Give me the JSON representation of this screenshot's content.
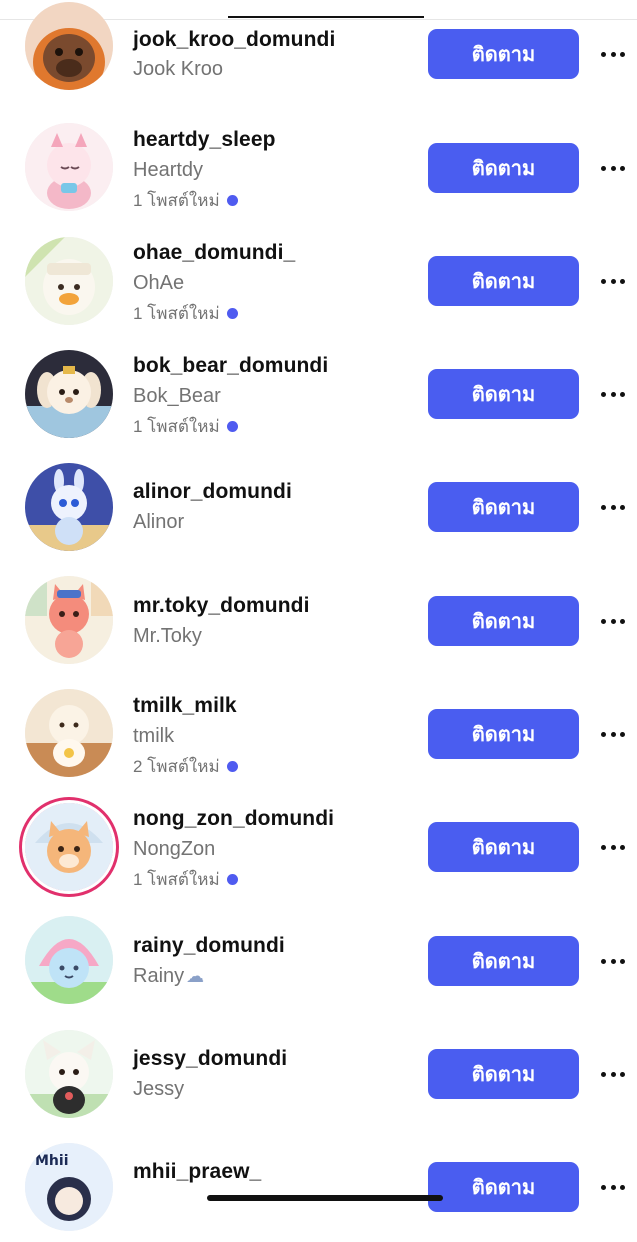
{
  "follow_label": "ติดตาม",
  "colors": {
    "accent": "#4a5df0",
    "new_post_dot": "#4f5bf0",
    "story_ring": "#e1306c",
    "secondary_text": "#737373"
  },
  "accounts": [
    {
      "username": "jook_kroo_domundi",
      "full_name": "Jook Kroo",
      "new_posts": ""
    },
    {
      "username": "heartdy_sleep",
      "full_name": "Heartdy",
      "new_posts": "1 โพสต์ใหม่"
    },
    {
      "username": "ohae_domundi_",
      "full_name": "OhAe",
      "new_posts": "1 โพสต์ใหม่"
    },
    {
      "username": "bok_bear_domundi",
      "full_name": "Bok_Bear",
      "new_posts": "1 โพสต์ใหม่"
    },
    {
      "username": "alinor_domundi",
      "full_name": "Alinor",
      "new_posts": ""
    },
    {
      "username": "mr.toky_domundi",
      "full_name": "Mr.Toky",
      "new_posts": ""
    },
    {
      "username": "tmilk_milk",
      "full_name": "tmilk",
      "new_posts": "2 โพสต์ใหม่"
    },
    {
      "username": "nong_zon_domundi",
      "full_name": "NongZon",
      "new_posts": "1 โพสต์ใหม่",
      "story_ring": true
    },
    {
      "username": "rainy_domundi",
      "full_name": "Rainy",
      "new_posts": "",
      "name_emoji": "cloud-rain-icon"
    },
    {
      "username": "jessy_domundi",
      "full_name": "Jessy",
      "new_posts": ""
    },
    {
      "username": "mhii_praew_",
      "full_name": "",
      "new_posts": ""
    }
  ]
}
